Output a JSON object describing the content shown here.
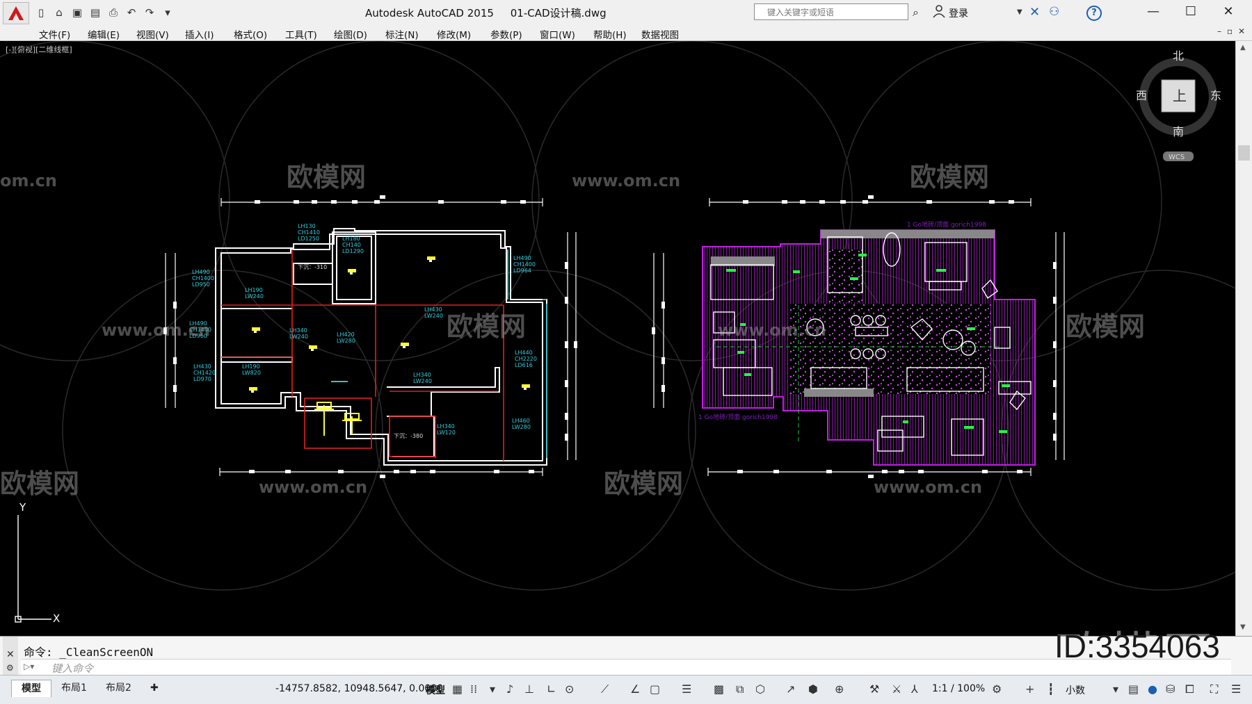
{
  "window": {
    "app_name": "Autodesk AutoCAD 2015",
    "file_name": "01-CAD设计稿.dwg",
    "search_placeholder": "键入关键字或短语",
    "login_label": "登录",
    "minimize": "—",
    "maximize": "☐",
    "close": "✕"
  },
  "menu": [
    "文件(F)",
    "编辑(E)",
    "视图(V)",
    "插入(I)",
    "格式(O)",
    "工具(T)",
    "绘图(D)",
    "标注(N)",
    "修改(M)",
    "参数(P)",
    "窗口(W)",
    "帮助(H)",
    "数据视图"
  ],
  "viewport": {
    "label": "[-][俯视][二维线框]",
    "viewcube": {
      "north": "北",
      "south": "南",
      "east": "东",
      "west": "西",
      "face": "上",
      "wcs": "WCS"
    },
    "ucs": {
      "x": "X",
      "y": "Y"
    }
  },
  "plan_left": {
    "room_labels": [
      [
        "LH130",
        "CH1410",
        "LD1250"
      ],
      [
        "LH180",
        "CH140",
        "LD1290"
      ],
      [
        "LH490",
        "CH1400",
        "LD950"
      ],
      [
        "LH190",
        "LW240"
      ],
      [
        "LH490",
        "CH1400",
        "LD960"
      ],
      [
        "LH490",
        "CH1400",
        "LD964"
      ],
      [
        "LH430",
        "LW240"
      ],
      [
        "LH340",
        "LW240"
      ],
      [
        "LH420",
        "LW280"
      ],
      [
        "LH430",
        "CH1420",
        "LD970"
      ],
      [
        "LH190",
        "LW820"
      ],
      [
        "LH340",
        "LW240"
      ],
      [
        "LH440",
        "CH2220",
        "LD616"
      ],
      [
        "LH340",
        "LW120"
      ],
      [
        "LH460",
        "LW280"
      ],
      [
        "下沉：-310"
      ],
      [
        "下沉：-380"
      ]
    ]
  },
  "plan_right": {
    "caption_top": "1 Go地砖/顶面  gorich1998",
    "caption_bottom": "1 Go地砖/顶面  gorich1998"
  },
  "watermarks": {
    "brand": "欧模网",
    "url": "www.om.cn",
    "url_short": "om.cn",
    "id": "ID:3354063"
  },
  "command": {
    "history": "命令: _CleanScreenON",
    "placeholder": "键入命令"
  },
  "status": {
    "tabs": [
      "模型",
      "布局1",
      "布局2"
    ],
    "coords": "-14757.8582, 10948.5647, 0.0000",
    "space": "模型",
    "scale": "1:1 / 100%",
    "units": "小数"
  },
  "colors": {
    "wall": "#ffffff",
    "red_line": "#e02020",
    "cyan_line": "#40c0c0",
    "label_cyan": "#30d0e0",
    "magenta": "#c020e0",
    "green": "#20ff40",
    "yellow": "#ffff30"
  }
}
